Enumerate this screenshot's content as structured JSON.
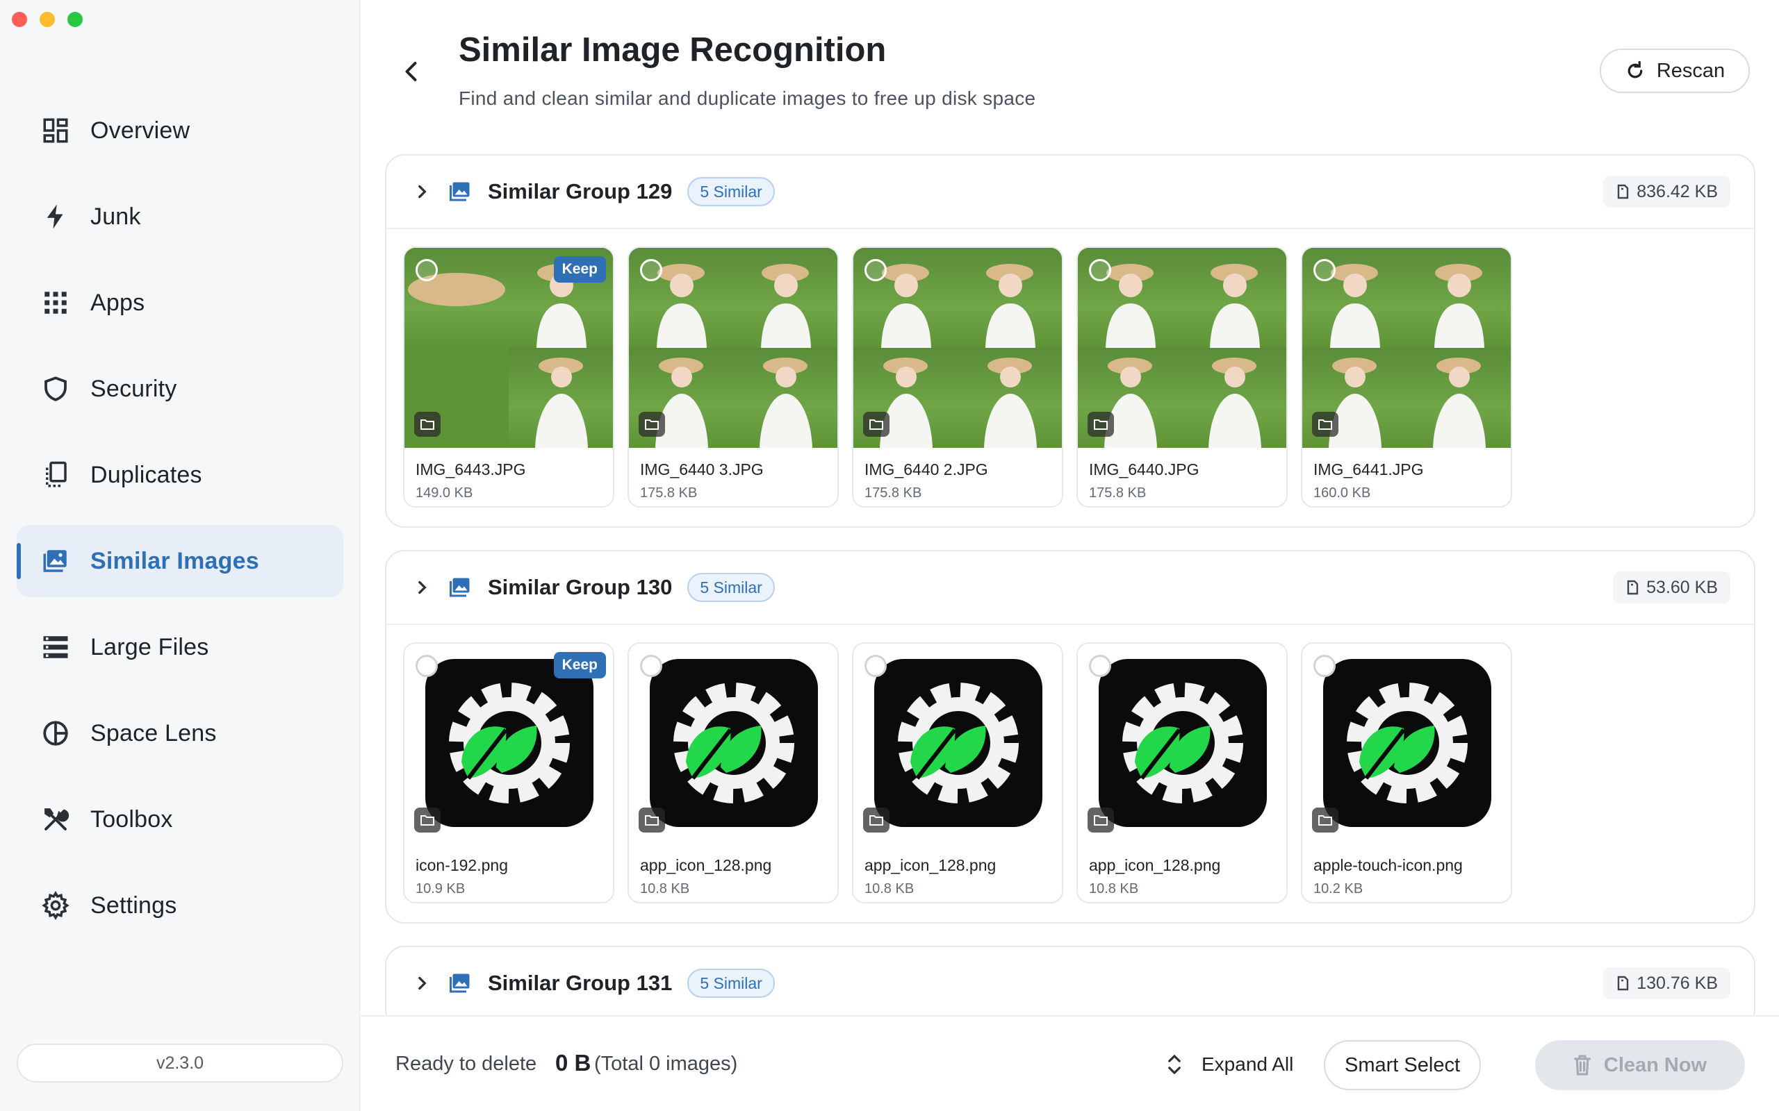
{
  "window": {
    "traffic_lights": [
      "close",
      "minimize",
      "zoom"
    ]
  },
  "sidebar": {
    "items": [
      {
        "label": "Overview",
        "icon": "overview-grid-icon",
        "active": false
      },
      {
        "label": "Junk",
        "icon": "lightning-icon",
        "active": false
      },
      {
        "label": "Apps",
        "icon": "apps-grid-icon",
        "active": false
      },
      {
        "label": "Security",
        "icon": "shield-icon",
        "active": false
      },
      {
        "label": "Duplicates",
        "icon": "duplicates-icon",
        "active": false
      },
      {
        "label": "Similar Images",
        "icon": "image-stack-icon",
        "active": true
      },
      {
        "label": "Large Files",
        "icon": "stacked-bars-icon",
        "active": false
      },
      {
        "label": "Space Lens",
        "icon": "pie-lens-icon",
        "active": false
      },
      {
        "label": "Toolbox",
        "icon": "tools-icon",
        "active": false
      },
      {
        "label": "Settings",
        "icon": "gear-icon",
        "active": false
      }
    ],
    "version": "v2.3.0"
  },
  "header": {
    "title": "Similar Image Recognition",
    "subtitle": "Find and clean similar and duplicate images to free up disk space",
    "rescan_label": "Rescan"
  },
  "groups": [
    {
      "title": "Similar Group 129",
      "badge": "5 Similar",
      "size": "836.42 KB",
      "items": [
        {
          "name": "IMG_6443.JPG",
          "size": "149.0 KB",
          "keep": "Keep",
          "type": "photo"
        },
        {
          "name": "IMG_6440 3.JPG",
          "size": "175.8 KB",
          "keep": "",
          "type": "photo"
        },
        {
          "name": "IMG_6440 2.JPG",
          "size": "175.8 KB",
          "keep": "",
          "type": "photo"
        },
        {
          "name": "IMG_6440.JPG",
          "size": "175.8 KB",
          "keep": "",
          "type": "photo"
        },
        {
          "name": "IMG_6441.JPG",
          "size": "160.0 KB",
          "keep": "",
          "type": "photo"
        }
      ]
    },
    {
      "title": "Similar Group 130",
      "badge": "5 Similar",
      "size": "53.60 KB",
      "items": [
        {
          "name": "icon-192.png",
          "size": "10.9 KB",
          "keep": "Keep",
          "type": "icon"
        },
        {
          "name": "app_icon_128.png",
          "size": "10.8 KB",
          "keep": "",
          "type": "icon"
        },
        {
          "name": "app_icon_128.png",
          "size": "10.8 KB",
          "keep": "",
          "type": "icon"
        },
        {
          "name": "app_icon_128.png",
          "size": "10.8 KB",
          "keep": "",
          "type": "icon"
        },
        {
          "name": "apple-touch-icon.png",
          "size": "10.2 KB",
          "keep": "",
          "type": "icon"
        }
      ]
    },
    {
      "title": "Similar Group 131",
      "badge": "5 Similar",
      "size": "130.76 KB"
    }
  ],
  "footer": {
    "ready_label": "Ready to delete",
    "ready_size": "0 B",
    "ready_total": "(Total 0 images)",
    "expand_all_label": "Expand All",
    "smart_select_label": "Smart Select",
    "clean_now_label": "Clean Now"
  },
  "colors": {
    "accent": "#2f6fb5",
    "sidebar_bg": "#f6f7f9",
    "active_bg": "#e8eef8",
    "leaf_green": "#22d84a",
    "icon_bg": "#0b0b0b"
  }
}
